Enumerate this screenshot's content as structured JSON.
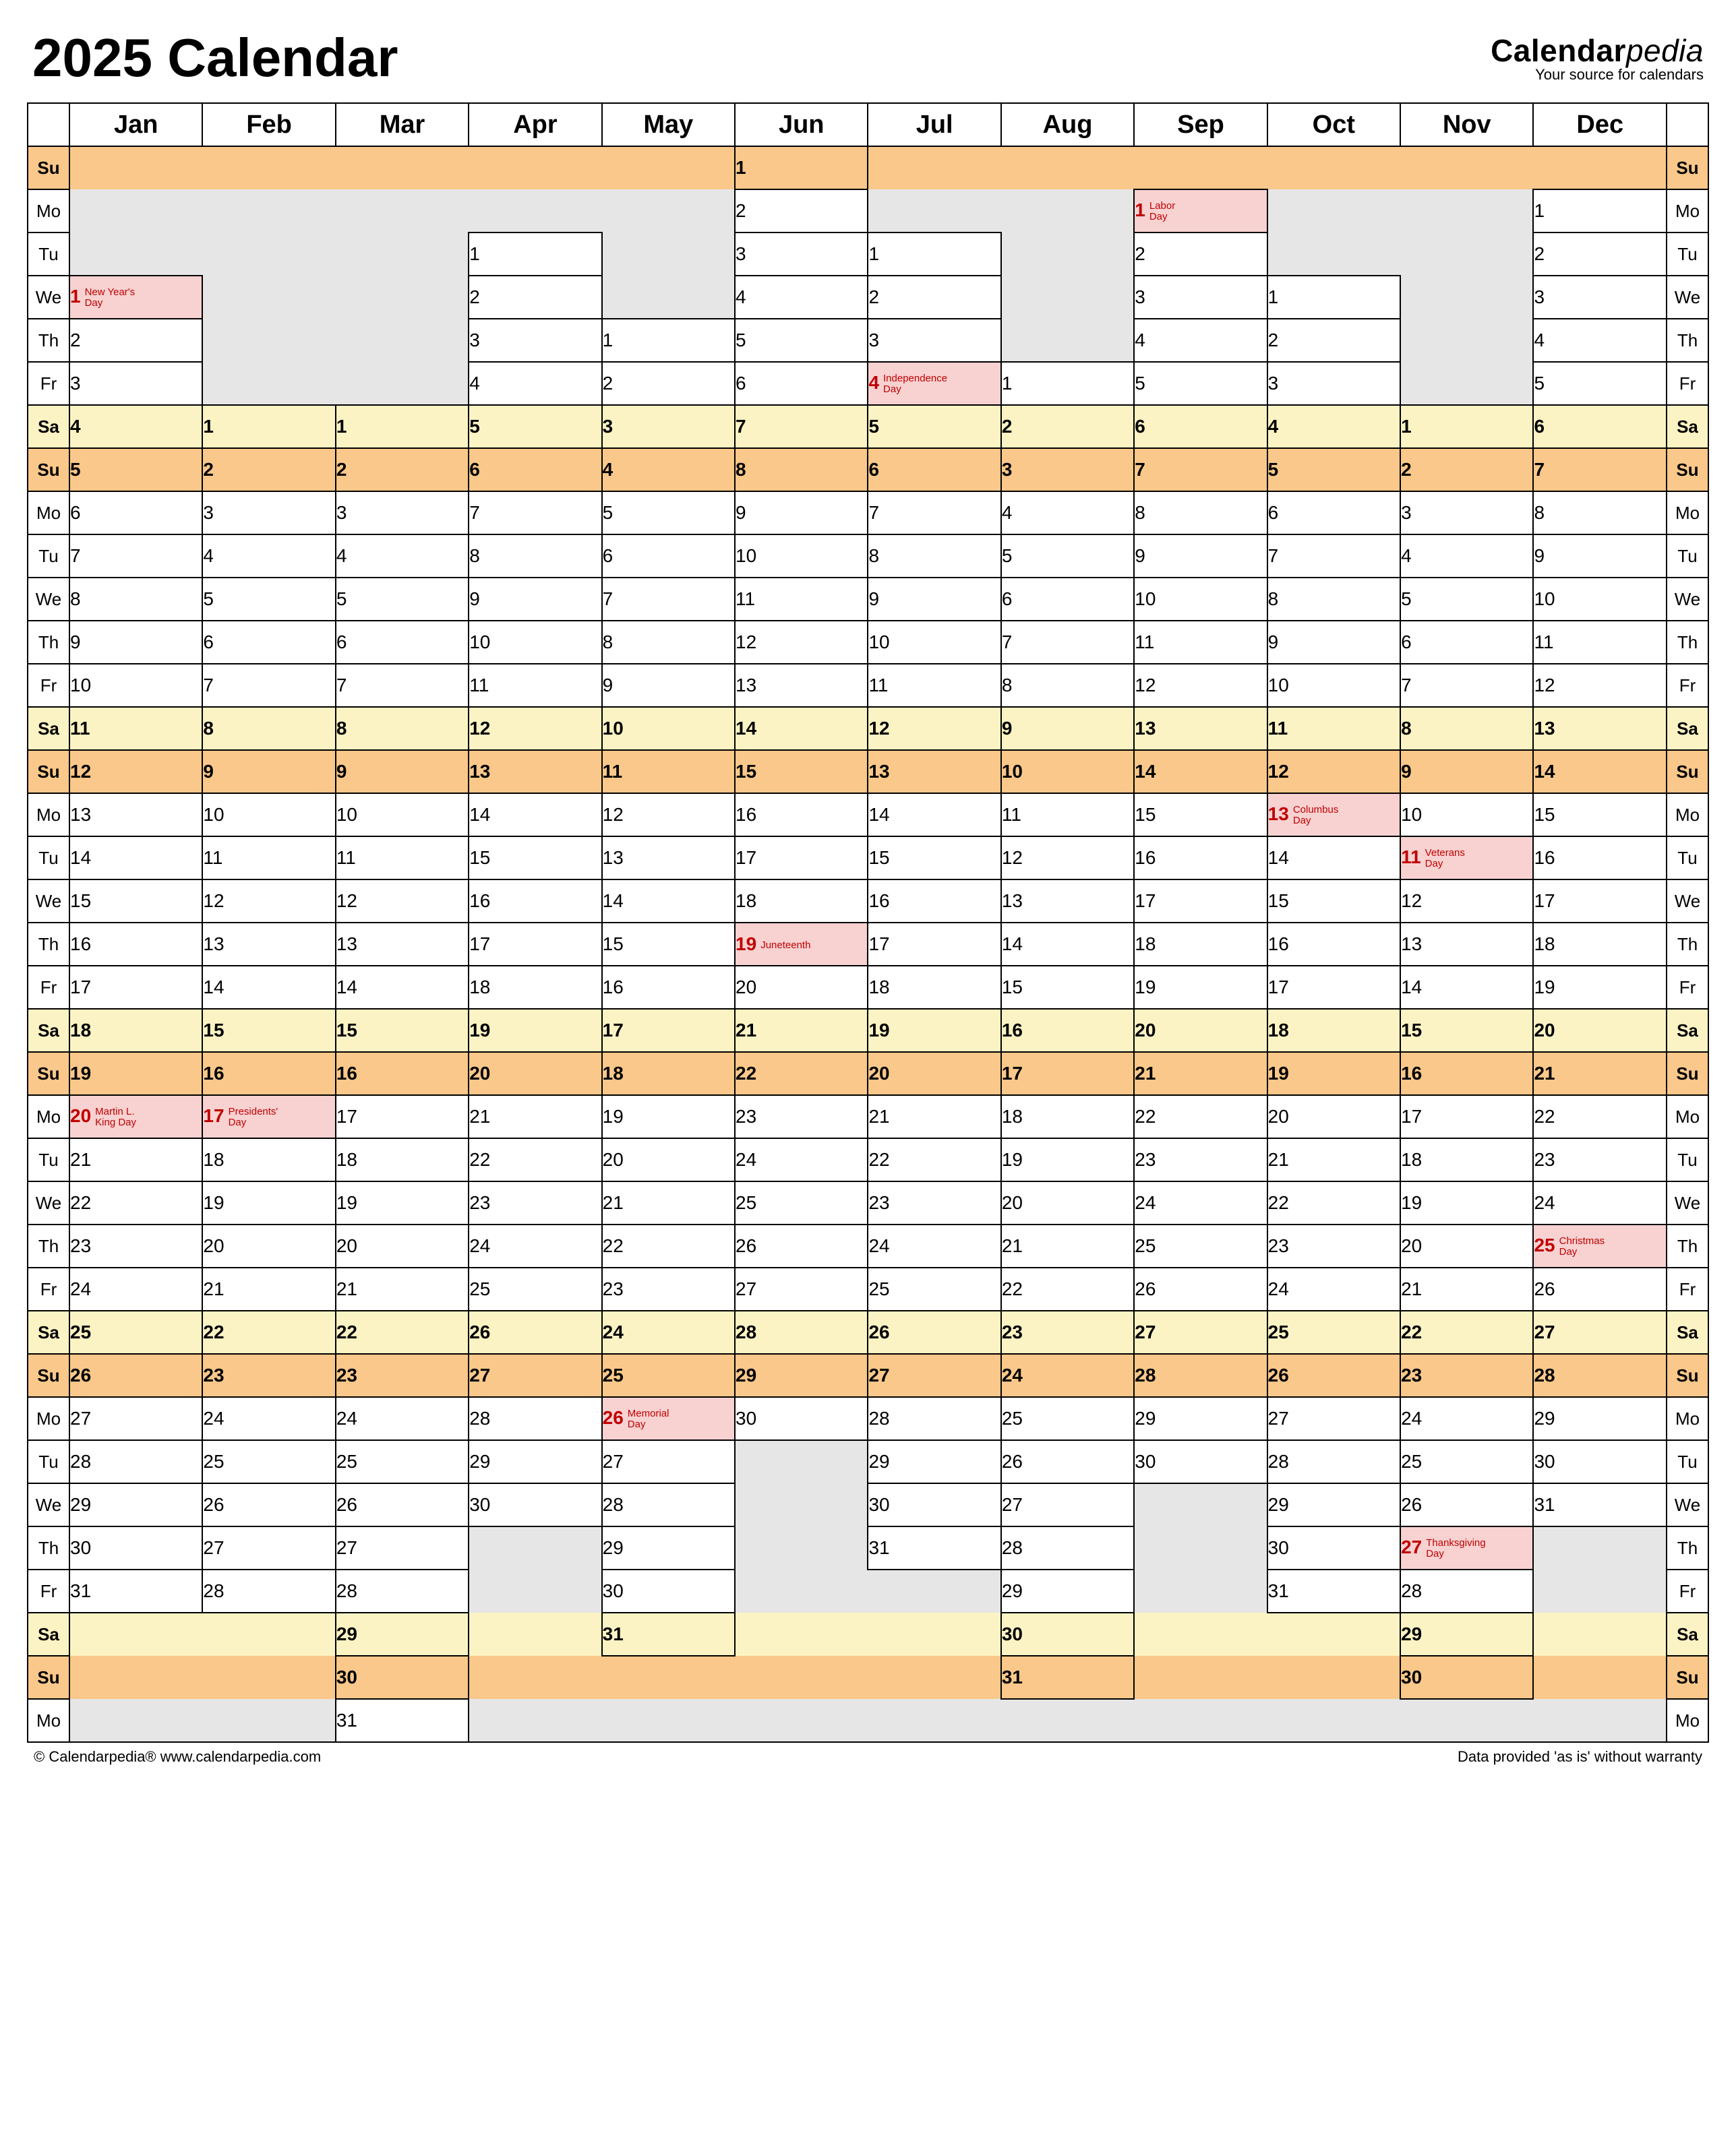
{
  "title": "2025 Calendar",
  "brand": {
    "name_a": "Calendar",
    "name_b": "pedia",
    "tagline": "Your source for calendars"
  },
  "footer": {
    "left": "© Calendarpedia®   www.calendarpedia.com",
    "right": "Data provided 'as is' without warranty"
  },
  "dow_labels": [
    "Su",
    "Mo",
    "Tu",
    "We",
    "Th",
    "Fr",
    "Sa",
    "Su",
    "Mo",
    "Tu",
    "We",
    "Th",
    "Fr",
    "Sa",
    "Su",
    "Mo",
    "Tu",
    "We",
    "Th",
    "Fr",
    "Sa",
    "Su",
    "Mo",
    "Tu",
    "We",
    "Th",
    "Fr",
    "Sa",
    "Su",
    "Mo",
    "Tu",
    "We",
    "Th",
    "Fr",
    "Sa",
    "Su",
    "Mo"
  ],
  "months": [
    "Jan",
    "Feb",
    "Mar",
    "Apr",
    "May",
    "Jun",
    "Jul",
    "Aug",
    "Sep",
    "Oct",
    "Nov",
    "Dec"
  ],
  "month_offsets": [
    3,
    6,
    6,
    2,
    4,
    0,
    2,
    5,
    1,
    3,
    6,
    1
  ],
  "month_lengths": [
    31,
    28,
    31,
    30,
    31,
    30,
    31,
    31,
    30,
    31,
    30,
    31
  ],
  "holidays": {
    "Jan": {
      "1": "New Year's Day",
      "20": "Martin L. King Day"
    },
    "Feb": {
      "17": "Presi­dents' Day"
    },
    "May": {
      "26": "Memorial Day"
    },
    "Jun": {
      "19": "Juneteenth"
    },
    "Jul": {
      "4": "Indepen­dence Day"
    },
    "Sep": {
      "1": "Labor Day"
    },
    "Oct": {
      "13": "Columbus Day"
    },
    "Nov": {
      "11": "Veterans Day",
      "27": "Thanks­giving Day"
    },
    "Dec": {
      "25": "Christmas Day"
    }
  }
}
